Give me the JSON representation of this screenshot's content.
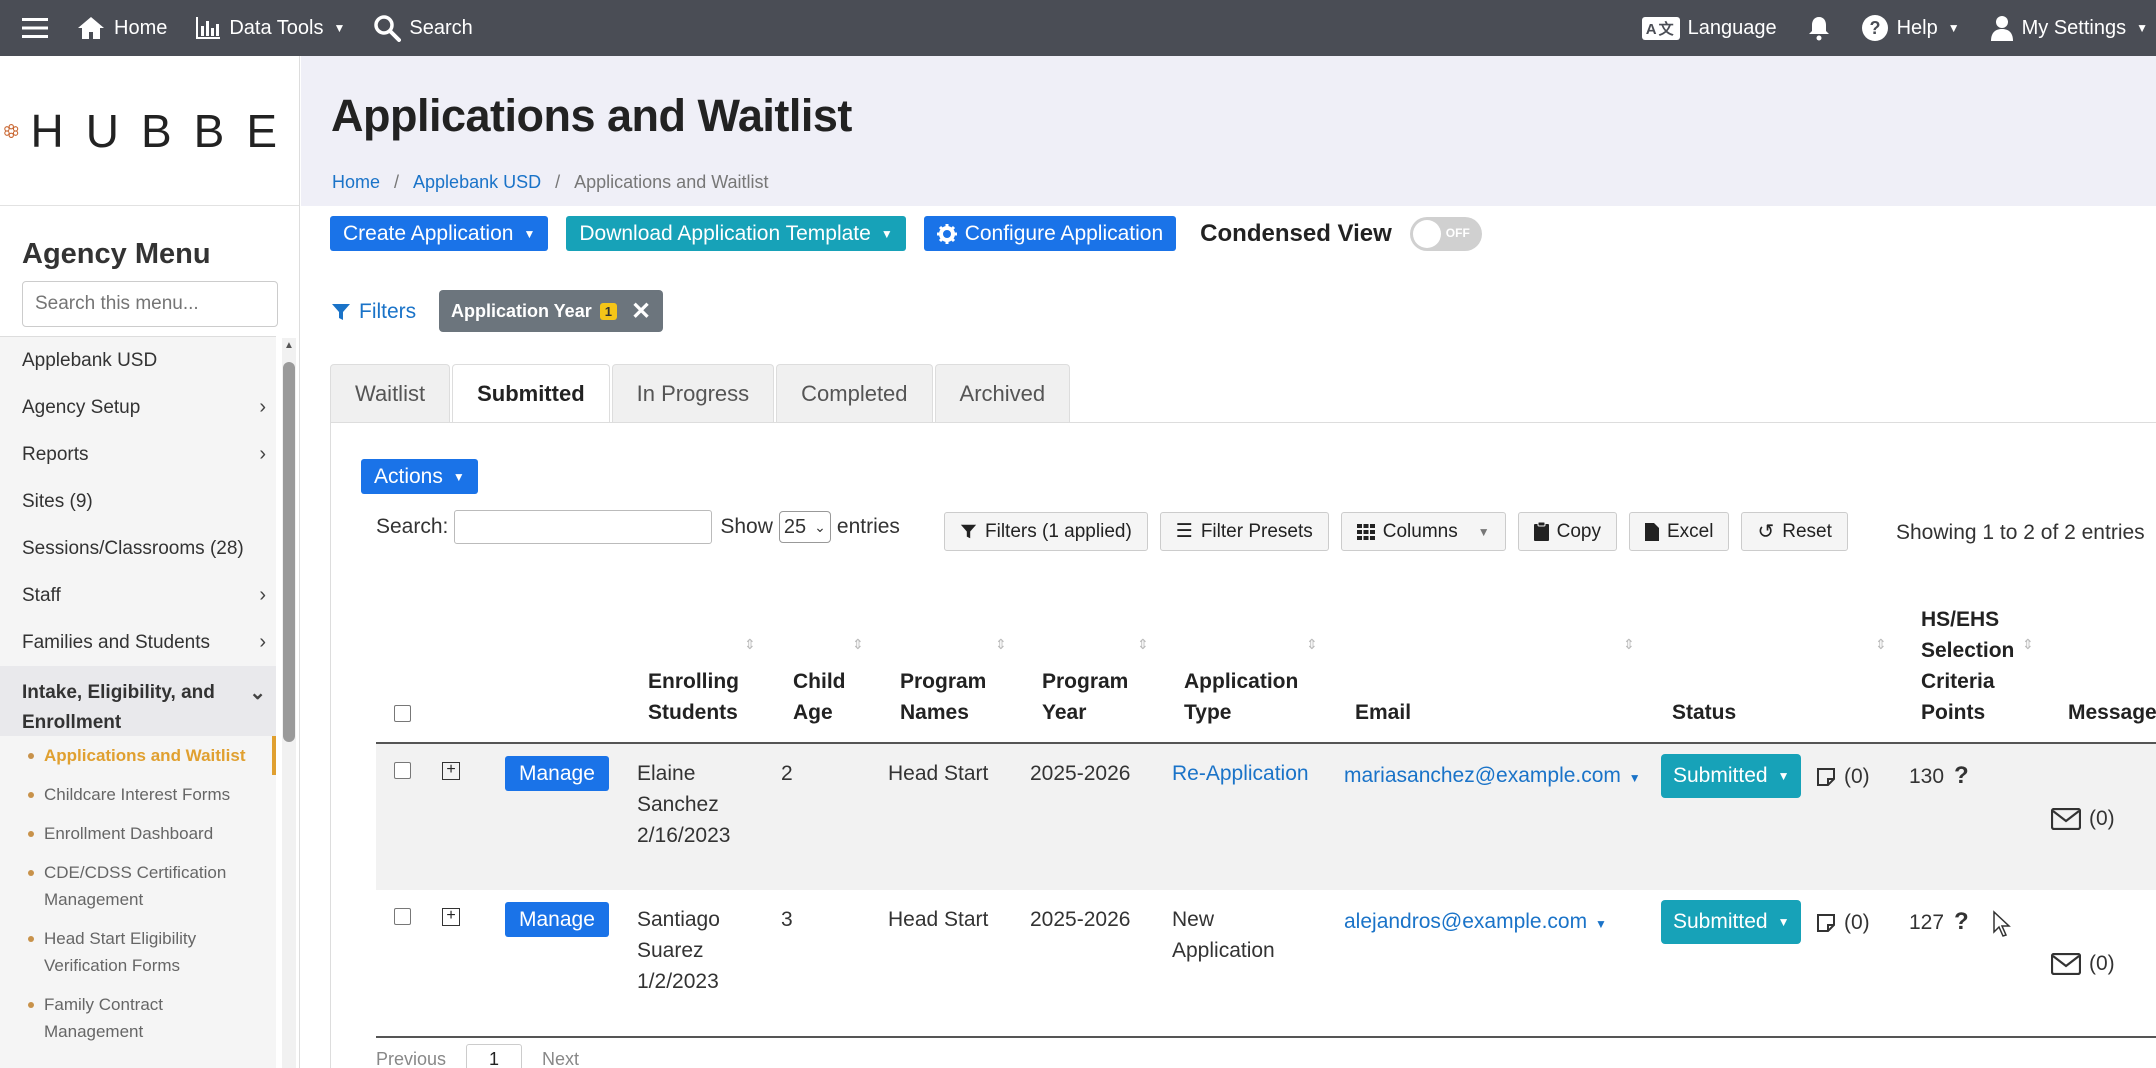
{
  "topnav": {
    "menu_icon": "hamburger-icon",
    "home": "Home",
    "data_tools": "Data Tools",
    "search": "Search",
    "language_badge": "A文",
    "language": "Language",
    "help": "Help",
    "my_settings": "My Settings"
  },
  "sidebar": {
    "logo_text": "HUBBE",
    "agency_title": "Agency Menu",
    "search_placeholder": "Search this menu...",
    "items": [
      {
        "label": "Applebank USD",
        "chevron": ""
      },
      {
        "label": "Agency Setup",
        "chevron": "›"
      },
      {
        "label": "Reports",
        "chevron": "›"
      },
      {
        "label": "Sites (9)",
        "chevron": ""
      },
      {
        "label": "Sessions/Classrooms (28)",
        "chevron": ""
      },
      {
        "label": "Staff",
        "chevron": "›"
      },
      {
        "label": "Families and Students",
        "chevron": "›"
      }
    ],
    "open_item": {
      "label": "Intake, Eligibility, and Enrollment",
      "chevron": "⌄"
    },
    "sub_items": [
      "Applications and Waitlist",
      "Childcare Interest Forms",
      "Enrollment Dashboard",
      "CDE/CDSS Certification Management",
      "Head Start Eligibility Verification Forms",
      "Family Contract Management"
    ]
  },
  "header": {
    "title": "Applications and Waitlist",
    "breadcrumb": [
      "Home",
      "Applebank USD",
      "Applications and Waitlist"
    ],
    "separator": "/"
  },
  "toolbar": {
    "create": "Create Application",
    "download": "Download Application Template",
    "configure": "Configure Application",
    "condensed_label": "Condensed View",
    "toggle_state": "OFF"
  },
  "filters": {
    "link": "Filters",
    "chip_label": "Application Year",
    "chip_count": "1"
  },
  "tabs": [
    "Waitlist",
    "Submitted",
    "In Progress",
    "Completed",
    "Archived"
  ],
  "active_tab": "Submitted",
  "table_controls": {
    "actions": "Actions",
    "search_label": "Search:",
    "show_label": "Show",
    "show_value": "25",
    "entries_label": "entries",
    "filters_applied": "Filters (1 applied)",
    "filter_presets": "Filter Presets",
    "columns": "Columns",
    "copy": "Copy",
    "excel": "Excel",
    "reset": "Reset",
    "showing": "Showing 1 to 2 of 2 entries"
  },
  "table": {
    "headers": {
      "enrolling": "Enrolling Students",
      "age": "Child Age",
      "program": "Program Names",
      "year": "Program Year",
      "type": "Application Type",
      "email": "Email",
      "status": "Status",
      "points": "HS/EHS Selection Criteria Points",
      "messages": "Messages"
    },
    "rows": [
      {
        "manage": "Manage",
        "student": "Elaine Sanchez 2/16/2023",
        "age": "2",
        "program": "Head Start",
        "year": "2025-2026",
        "type": "Re-Application",
        "email": "mariasanchez@example.com",
        "status": "Submitted",
        "notes": "(0)",
        "points": "130",
        "messages": "(0)"
      },
      {
        "manage": "Manage",
        "student": "Santiago Suarez 1/2/2023",
        "age": "3",
        "program": "Head Start",
        "year": "2025-2026",
        "type": "New Application",
        "email": "alejandros@example.com",
        "status": "Submitted",
        "notes": "(0)",
        "points": "127",
        "messages": "(0)"
      }
    ]
  },
  "pager": {
    "previous": "Previous",
    "page": "1",
    "next": "Next"
  }
}
